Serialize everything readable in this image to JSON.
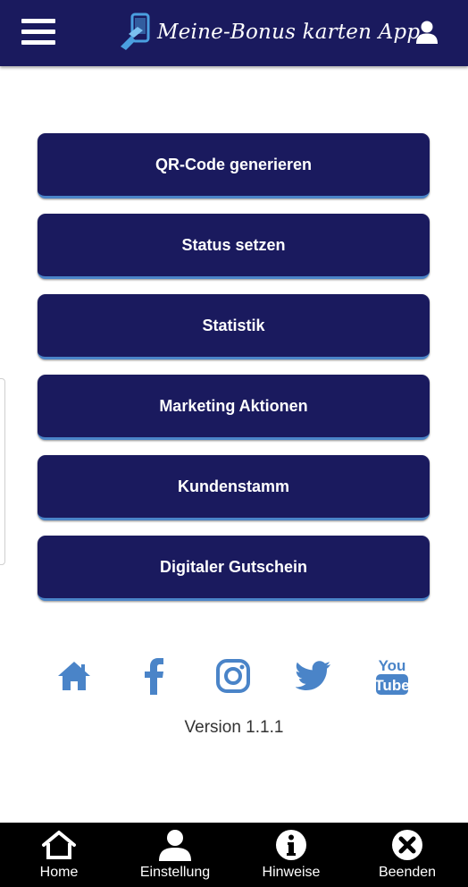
{
  "header": {
    "app_title": "Meine-Bonus karten App",
    "background": "#1a1a5e",
    "menu_icon": "hamburger-icon",
    "user_icon": "user-icon"
  },
  "menu": {
    "button_color": "#1a1a5e",
    "accent_color": "#4a84c8",
    "items": [
      {
        "label": "QR-Code generieren"
      },
      {
        "label": "Status setzen"
      },
      {
        "label": "Statistik"
      },
      {
        "label": "Marketing Aktionen"
      },
      {
        "label": "Kundenstamm"
      },
      {
        "label": "Digitaler Gutschein"
      }
    ]
  },
  "social": {
    "icon_color": "#4a84c8",
    "icons": [
      "home-icon",
      "facebook-icon",
      "instagram-icon",
      "twitter-icon",
      "youtube-icon"
    ],
    "youtube_line1": "You",
    "youtube_line2": "Tube"
  },
  "version": "Version 1.1.1",
  "bottom_nav": {
    "items": [
      {
        "label": "Home",
        "icon": "home-outline-icon"
      },
      {
        "label": "Einstellung",
        "icon": "user-icon"
      },
      {
        "label": "Hinweise",
        "icon": "info-icon"
      },
      {
        "label": "Beenden",
        "icon": "close-circle-icon"
      }
    ]
  }
}
